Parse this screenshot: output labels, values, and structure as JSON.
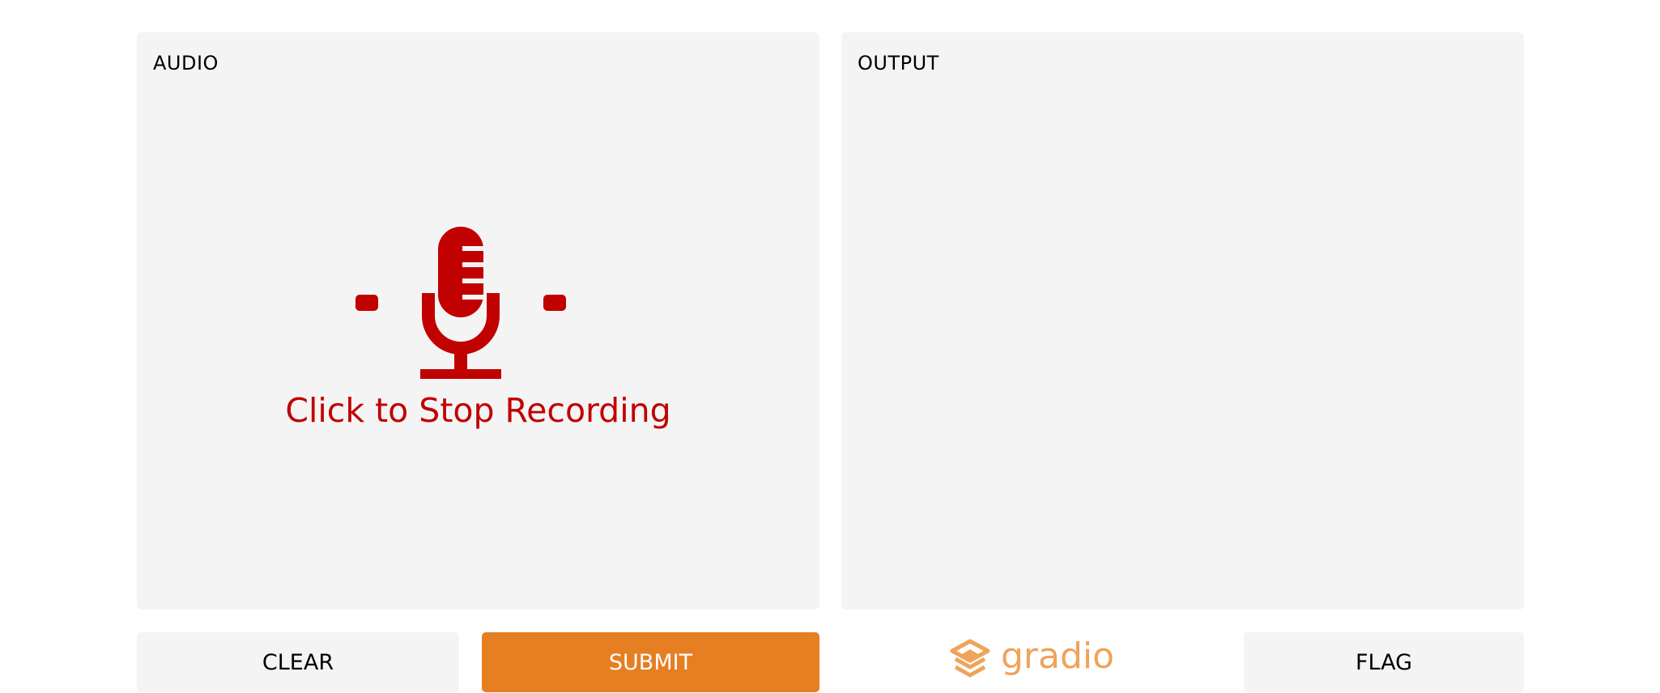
{
  "audio_panel": {
    "label": "AUDIO",
    "record_prompt": "Click to Stop Recording",
    "icon": "microphone-icon"
  },
  "output_panel": {
    "label": "OUTPUT"
  },
  "buttons": {
    "clear_label": "CLEAR",
    "submit_label": "SUBMIT",
    "flag_label": "FLAG"
  },
  "branding": {
    "logo_text": "gradio",
    "icon": "gradio-logo-icon"
  },
  "colors": {
    "recording_red": "#c10000",
    "submit_orange": "#e67e22",
    "logo_orange": "#eea45a",
    "panel_bg": "#f4f4f4"
  }
}
